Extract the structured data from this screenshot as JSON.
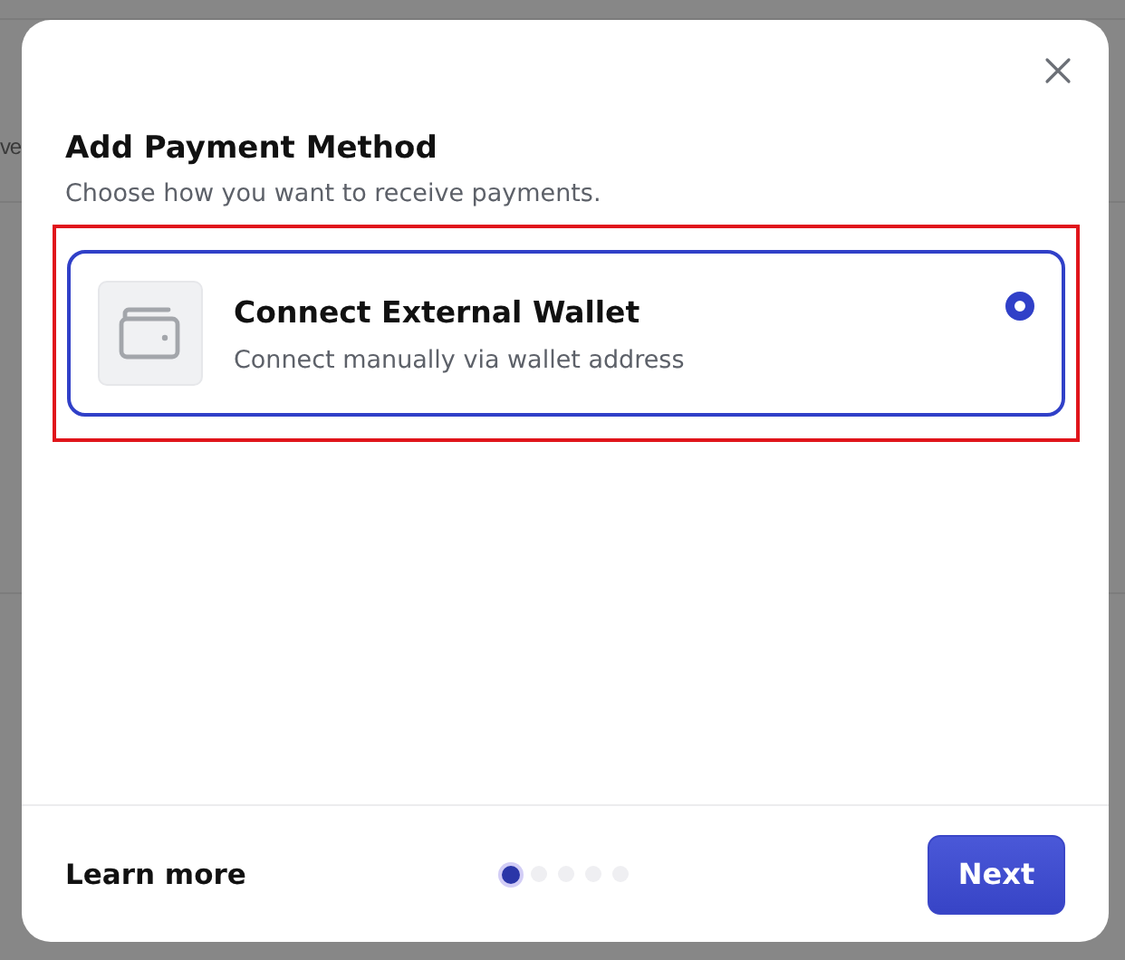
{
  "background": {
    "text": "ve"
  },
  "dialog": {
    "title": "Add Payment Method",
    "subtitle": "Choose how you want to receive payments.",
    "options": [
      {
        "title": "Connect External Wallet",
        "description": "Connect manually via wallet address",
        "selected": true,
        "highlighted": true
      }
    ],
    "footer": {
      "link": "Learn more",
      "steps": [
        {
          "selected": true
        },
        {
          "selected": false
        },
        {
          "selected": false
        },
        {
          "selected": false
        },
        {
          "selected": false
        }
      ],
      "button": "Next"
    }
  }
}
